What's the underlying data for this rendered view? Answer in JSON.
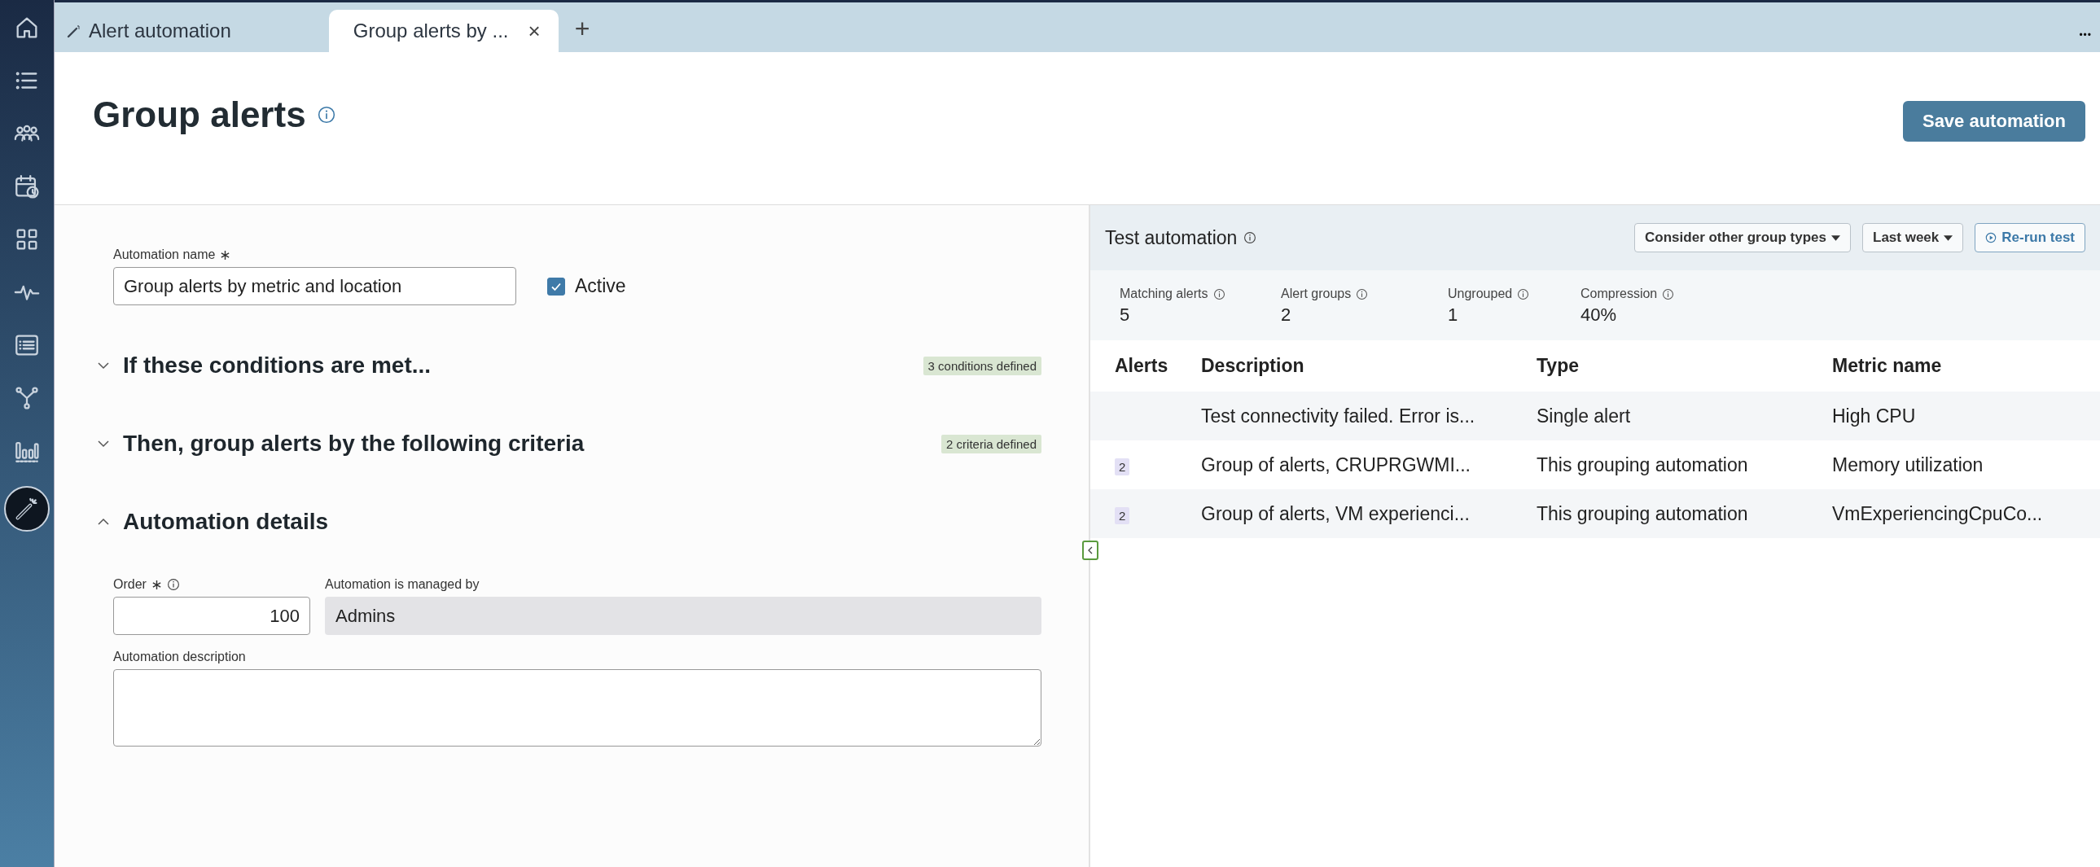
{
  "sidebar": [
    {
      "selected": false
    },
    {
      "selected": false
    },
    {
      "selected": false
    },
    {
      "selected": false
    },
    {
      "selected": false
    },
    {
      "selected": false
    },
    {
      "selected": false
    },
    {
      "selected": false
    },
    {
      "selected": false
    },
    {
      "selected": true
    }
  ],
  "tabs": [
    {
      "label": "Alert automation",
      "selected": false,
      "closable": false
    },
    {
      "label": "Group alerts by ...",
      "selected": true,
      "closable": true,
      "close": "×"
    }
  ],
  "tab_actions": {
    "add": "+",
    "more": "•••"
  },
  "header": {
    "title": "Group alerts",
    "save_button": "Save automation"
  },
  "form": {
    "name_label": "Automation name",
    "name_value": "Group alerts by metric and location",
    "active": {
      "label": "Active",
      "checked": true
    }
  },
  "sections": [
    {
      "title": "If these conditions are met...",
      "expanded": false,
      "badge": "3 conditions defined"
    },
    {
      "title": "Then, group alerts by the following criteria",
      "expanded": false,
      "badge": "2 criteria defined"
    },
    {
      "title": "Automation details",
      "expanded": true
    }
  ],
  "details": {
    "order_label": "Order",
    "order_value": "100",
    "managed_label": "Automation is managed by",
    "managed_value": "Admins",
    "description_label": "Automation description"
  },
  "test_panel": {
    "title": "Test automation",
    "group_types": "Consider other group types",
    "period": "Last week",
    "rerun": "Re-run test",
    "stats": [
      {
        "label": "Matching alerts",
        "value": "5"
      },
      {
        "label": "Alert groups",
        "value": "2"
      },
      {
        "label": "Ungrouped",
        "value": "1"
      },
      {
        "label": "Compression",
        "value": "40%"
      }
    ],
    "columns": [
      "Alerts",
      "Description",
      "Type",
      "Metric name"
    ],
    "rows": [
      {
        "description": "Test connectivity failed. Error is...",
        "type": "Single alert",
        "metric": "High CPU"
      },
      {
        "alerts": "2",
        "description": "Group of alerts, CRUPRGWMI...",
        "type": "This grouping automation",
        "metric": "Memory utilization"
      },
      {
        "alerts": "2",
        "description": "Group of alerts, VM experienci...",
        "type": "This grouping automation",
        "metric": "VmExperiencingCpuCo..."
      }
    ]
  }
}
